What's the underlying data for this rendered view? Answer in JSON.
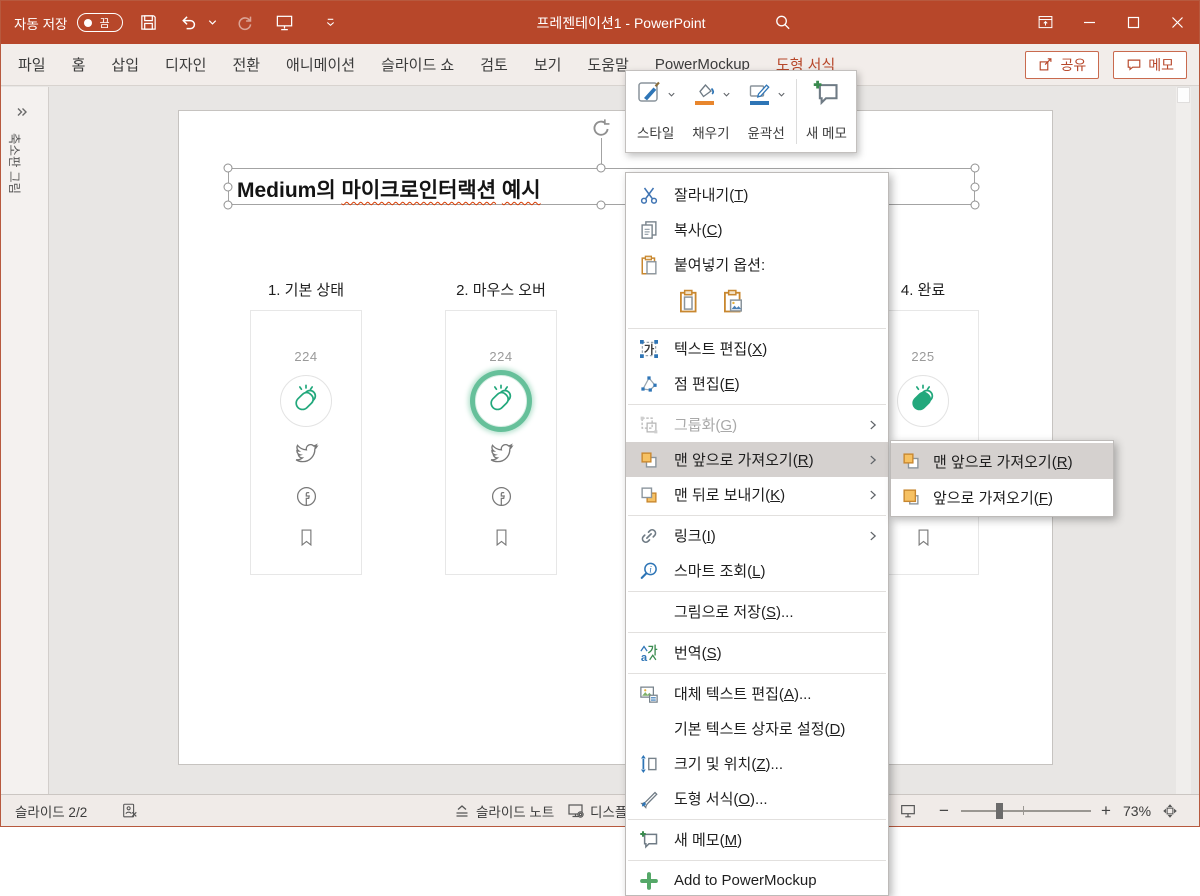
{
  "titlebar": {
    "autosave_label": "자동 저장",
    "autosave_state": "끔",
    "title": "프레젠테이션1  -  PowerPoint"
  },
  "ribbon": {
    "tabs": [
      {
        "name": "file",
        "label": "파일"
      },
      {
        "name": "home",
        "label": "홈"
      },
      {
        "name": "insert",
        "label": "삽입"
      },
      {
        "name": "design",
        "label": "디자인"
      },
      {
        "name": "transitions",
        "label": "전환"
      },
      {
        "name": "animations",
        "label": "애니메이션"
      },
      {
        "name": "slideshow",
        "label": "슬라이드 쇼"
      },
      {
        "name": "review",
        "label": "검토"
      },
      {
        "name": "view",
        "label": "보기"
      },
      {
        "name": "help",
        "label": "도움말"
      },
      {
        "name": "powermockup",
        "label": "PowerMockup"
      },
      {
        "name": "shape-format",
        "label": "도형 서식",
        "contextual": true
      }
    ],
    "share_label": "공유",
    "comments_label": "메모"
  },
  "sidebar": {
    "collapsed_label": "축소판 그림"
  },
  "slide": {
    "title": {
      "part1": "Medium의 ",
      "part2": "마이크로인터랙션",
      "part3": " ",
      "part4": "예시"
    },
    "cards": [
      {
        "name": "default",
        "label": "1. 기본 상태",
        "count": "224",
        "clap": "outline",
        "ring": false
      },
      {
        "name": "hover",
        "label": "2. 마우스 오버",
        "count": "224",
        "clap": "outline",
        "ring": true
      },
      {
        "name": "complete",
        "label": "4. 완료",
        "count": "225",
        "clap": "filled",
        "ring": false
      }
    ]
  },
  "mini_toolbar": {
    "items": [
      {
        "name": "style",
        "icon": "style-icon",
        "label": "스타일",
        "dropdown": true
      },
      {
        "name": "fill",
        "icon": "fill-icon",
        "label": "채우기",
        "dropdown": true
      },
      {
        "name": "outline",
        "icon": "outline-icon",
        "label": "윤곽선",
        "dropdown": true
      },
      {
        "name": "new-comment",
        "icon": "new-comment-icon",
        "label": "새 메모",
        "dropdown": false,
        "sep_before": true
      }
    ]
  },
  "context_menu": {
    "items": [
      {
        "name": "cut",
        "icon": "cut-icon",
        "label": "잘라내기(_T_)"
      },
      {
        "name": "copy",
        "icon": "copy-icon",
        "label": "복사(_C_)"
      },
      {
        "name": "paste-options-label",
        "icon": "paste-icon",
        "label": "붙여넣기 옵션:"
      },
      {
        "type": "paste-options",
        "options": [
          {
            "name": "paste-keep-source",
            "icon": "paste-keep-icon"
          },
          {
            "name": "paste-as-picture",
            "icon": "paste-picture-icon"
          }
        ]
      },
      {
        "type": "sep"
      },
      {
        "name": "edit-text",
        "icon": "edit-text-icon",
        "label": "텍스트 편집(_X_)"
      },
      {
        "name": "edit-points",
        "icon": "edit-points-icon",
        "label": "점 편집(_E_)"
      },
      {
        "type": "sep"
      },
      {
        "name": "group",
        "icon": "group-icon",
        "label": "그룹화(_G_)",
        "disabled": true,
        "submenu": true
      },
      {
        "name": "bring-to-front",
        "icon": "bring-front-icon",
        "label": "맨 앞으로 가져오기(_R_)",
        "highlighted": true,
        "submenu": true
      },
      {
        "name": "send-to-back",
        "icon": "send-back-icon",
        "label": "맨 뒤로 보내기(_K_)",
        "submenu": true
      },
      {
        "type": "sep"
      },
      {
        "name": "link",
        "icon": "link-icon",
        "label": "링크(_I_)",
        "submenu": true
      },
      {
        "name": "smart-lookup",
        "icon": "smart-lookup-icon",
        "label": "스마트 조회(_L_)"
      },
      {
        "type": "sep"
      },
      {
        "name": "save-as-picture",
        "label": "그림으로 저장(_S_)..."
      },
      {
        "type": "sep"
      },
      {
        "name": "translate",
        "icon": "translate-icon",
        "label": "번역(_S_)"
      },
      {
        "type": "sep"
      },
      {
        "name": "edit-alt-text",
        "icon": "alt-text-icon",
        "label": "대체 텍스트 편집(_A_)..."
      },
      {
        "name": "set-default-textbox",
        "label": "기본 텍스트 상자로 설정(_D_)"
      },
      {
        "name": "size-position",
        "icon": "size-position-icon",
        "label": "크기 및 위치(_Z_)..."
      },
      {
        "name": "format-shape",
        "icon": "format-shape-icon",
        "label": "도형 서식(_O_)..."
      },
      {
        "type": "sep"
      },
      {
        "name": "new-comment",
        "icon": "new-comment-icon",
        "label": "새 메모(_M_)"
      },
      {
        "type": "sep"
      },
      {
        "name": "add-to-powermockup",
        "icon": "add-icon",
        "label": "Add to PowerMockup"
      }
    ]
  },
  "submenu": {
    "items": [
      {
        "name": "bring-to-front",
        "icon": "bring-front-icon",
        "label": "맨 앞으로 가져오기(_R_)",
        "highlighted": true
      },
      {
        "name": "bring-forward",
        "icon": "bring-forward-icon",
        "label": "앞으로 가져오기(_F_)"
      }
    ]
  },
  "status_bar": {
    "slide_indicator": "슬라이드 2/2",
    "notes_label": "슬라이드 노트",
    "display_label": "디스플레이 설정",
    "zoom_level": "73%"
  },
  "colors": {
    "titlebar": "#b7472a",
    "accent": "#b7472a",
    "clap_green": "#22a87c",
    "menu_highlight": "#d5d1cf",
    "shape_orange": "#f6c163",
    "misspell_red": "#d83b01"
  }
}
